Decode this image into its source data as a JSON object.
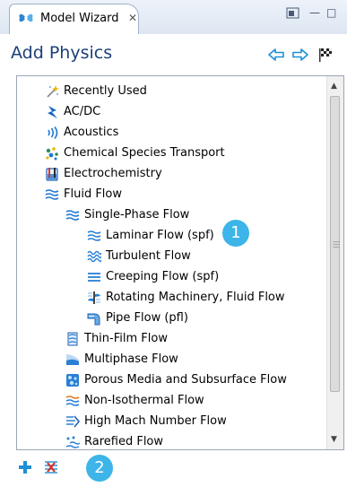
{
  "tab": {
    "title": "Model Wizard",
    "icon": "model-wizard-icon"
  },
  "window_controls": {
    "minimize": "—",
    "maximize": "□"
  },
  "panel": {
    "title": "Add Physics"
  },
  "tree": {
    "items": [
      {
        "label": "Recently Used",
        "icon": "sparkle-icon"
      },
      {
        "label": "AC/DC",
        "icon": "lightning-icon"
      },
      {
        "label": "Acoustics",
        "icon": "sound-waves-icon"
      },
      {
        "label": "Chemical Species Transport",
        "icon": "molecules-icon"
      },
      {
        "label": "Electrochemistry",
        "icon": "beaker-icon"
      },
      {
        "label": "Fluid Flow",
        "icon": "flow-waves-icon"
      },
      {
        "label": "Single-Phase Flow",
        "icon": "flow-waves-icon"
      },
      {
        "label": "Laminar Flow (spf)",
        "icon": "laminar-flow-icon"
      },
      {
        "label": "Turbulent Flow",
        "icon": "turbulent-flow-icon"
      },
      {
        "label": "Creeping Flow (spf)",
        "icon": "creeping-flow-icon"
      },
      {
        "label": "Rotating Machinery, Fluid Flow",
        "icon": "rotating-machinery-icon"
      },
      {
        "label": "Pipe Flow (pfl)",
        "icon": "pipe-flow-icon"
      },
      {
        "label": "Thin-Film Flow",
        "icon": "thin-film-icon"
      },
      {
        "label": "Multiphase Flow",
        "icon": "multiphase-icon"
      },
      {
        "label": "Porous Media and Subsurface Flow",
        "icon": "porous-media-icon"
      },
      {
        "label": "Non-Isothermal Flow",
        "icon": "non-isothermal-icon"
      },
      {
        "label": "High Mach Number Flow",
        "icon": "high-mach-icon"
      },
      {
        "label": "Rarefied Flow",
        "icon": "rarefied-flow-icon"
      }
    ]
  },
  "callouts": {
    "first": "1",
    "second": "2"
  },
  "colors": {
    "title": "#1c3f78",
    "callout": "#3db5e8",
    "arrow": "#1f8fd6"
  }
}
